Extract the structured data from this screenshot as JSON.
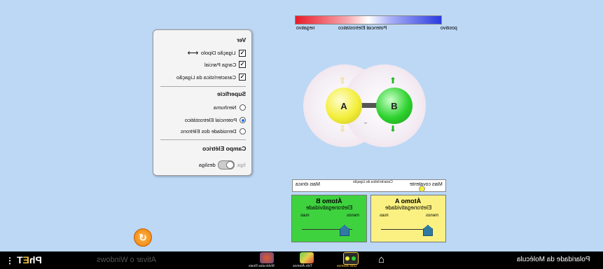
{
  "legend": {
    "title": "Potencial Eletrostático",
    "negative": "negativo",
    "positive": "positivo"
  },
  "panel": {
    "view_title": "Ver",
    "view_items": [
      "Ligação Dipolo",
      "Carga Parcial",
      "Característica da Ligação"
    ],
    "surface_title": "Superfície",
    "surface_items": [
      "Nenhuma",
      "Potencial Eletrostático",
      "Densidade dos Elétrons"
    ],
    "surface_selected": "Potencial Eletrostático",
    "field_title": "Campo Elétrico",
    "field_off": "desliga",
    "field_on": "liga"
  },
  "molecule": {
    "atom_a": "A",
    "atom_b": "B",
    "color_a": "#f3ee3a",
    "color_b": "#2ed22e"
  },
  "bond_character": {
    "title": "Característica da Ligação",
    "left": "Mais covalente",
    "right": "Mais iônica"
  },
  "atom_a_box": {
    "title": "Átomo A",
    "subtitle": "Eletronegatividade",
    "less": "menos",
    "more": "mais",
    "color": "#fbf182",
    "electronegativity_fraction": 0.15
  },
  "atom_b_box": {
    "title": "Átomo B",
    "subtitle": "Eletronegatividade",
    "less": "menos",
    "more": "mais",
    "color": "#3fd23f",
    "electronegativity_fraction": 0.15
  },
  "navbar": {
    "app_title": "Polaridade da Molécula",
    "tabs": [
      "Dois Átomos",
      "Três Átomos",
      "Moléculas Reais"
    ],
    "watermark": "Ativar o Windows",
    "brand": "PhET"
  }
}
